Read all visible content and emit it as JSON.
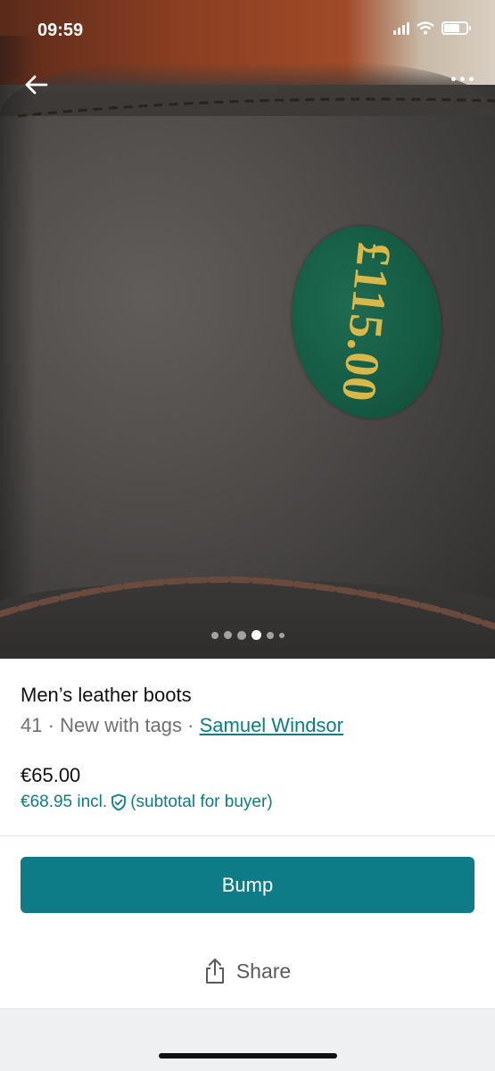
{
  "status_bar": {
    "time": "09:59"
  },
  "photo": {
    "sticker_text": "£115.00",
    "page_count": 6,
    "active_page": 4
  },
  "item": {
    "title": "Men’s leather boots",
    "size": "41",
    "separator": "·",
    "condition": "New with tags",
    "brand": "Samuel Windsor",
    "price": "€65.00",
    "price_incl": "€68.95 incl.",
    "price_incl_note": "(subtotal for buyer)"
  },
  "actions": {
    "bump_label": "Bump",
    "share_label": "Share"
  },
  "colors": {
    "accent": "#0e7c86",
    "sticker_green": "#155a43",
    "sticker_text": "#d8b84a"
  },
  "icons": [
    "back-arrow-icon",
    "more-options-icon",
    "shield-check-icon",
    "share-icon"
  ]
}
